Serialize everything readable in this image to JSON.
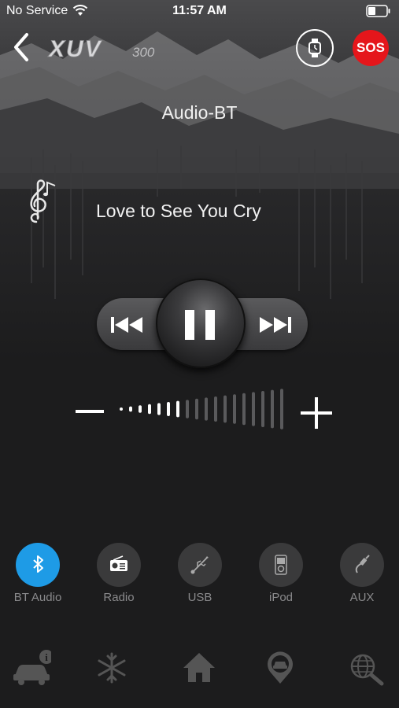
{
  "status_bar": {
    "carrier": "No Service",
    "time": "11:57 AM"
  },
  "header": {
    "logo_text": "XUV300",
    "sos_label": "SOS"
  },
  "player": {
    "source_title": "Audio-BT",
    "song_title": "Love to See You Cry",
    "state": "playing",
    "volume_level": 0.5
  },
  "sources": [
    {
      "label": "BT Audio",
      "icon": "bluetooth-icon",
      "active": true
    },
    {
      "label": "Radio",
      "icon": "radio-icon",
      "active": false
    },
    {
      "label": "USB",
      "icon": "usb-icon",
      "active": false
    },
    {
      "label": "iPod",
      "icon": "ipod-icon",
      "active": false
    },
    {
      "label": "AUX",
      "icon": "aux-icon",
      "active": false
    }
  ],
  "bottom_nav": [
    {
      "icon": "car-info-icon"
    },
    {
      "icon": "climate-snowflake-icon"
    },
    {
      "icon": "home-icon"
    },
    {
      "icon": "car-location-icon"
    },
    {
      "icon": "globe-search-icon"
    }
  ],
  "colors": {
    "accent": "#1e9be6",
    "sos": "#e5161b",
    "background": "#1c1c1d"
  }
}
